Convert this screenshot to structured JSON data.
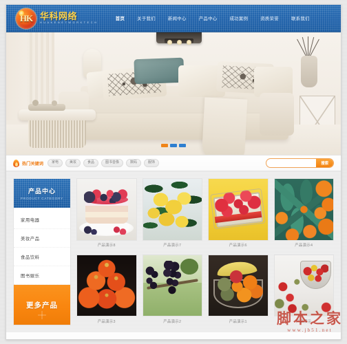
{
  "site": {
    "logo_cn": "华科网络",
    "logo_en": "H U A K E   N E T W O R K   T E C H",
    "logo_mark": "HK"
  },
  "nav": {
    "items": [
      {
        "label": "首页",
        "active": true
      },
      {
        "label": "关于我们",
        "active": false
      },
      {
        "label": "新闻中心",
        "active": false
      },
      {
        "label": "产品中心",
        "active": false
      },
      {
        "label": "成功案例",
        "active": false
      },
      {
        "label": "资质荣誉",
        "active": false
      },
      {
        "label": "联系我们",
        "active": false
      }
    ]
  },
  "banner": {
    "slides": [
      {
        "active": true
      },
      {
        "active": false
      },
      {
        "active": false
      }
    ]
  },
  "keyword_bar": {
    "label": "热门关键词",
    "tags": [
      "家电",
      "美妆",
      "食品",
      "图书音像",
      "数码",
      "服饰"
    ],
    "search": {
      "placeholder": "",
      "value": "",
      "button_label": "搜索"
    }
  },
  "sidebar": {
    "title_cn": "产品中心",
    "title_en": "PRODUCT CATEGORY",
    "items": [
      {
        "label": "家用电器"
      },
      {
        "label": "美妆产品"
      },
      {
        "label": "食品饮料"
      },
      {
        "label": "图书娱乐"
      }
    ],
    "more_label": "更多产品"
  },
  "products": [
    {
      "caption": "产品演示8",
      "art": "cake"
    },
    {
      "caption": "产品演示7",
      "art": "lemons"
    },
    {
      "caption": "产品演示6",
      "art": "rasp"
    },
    {
      "caption": "产品演示4",
      "art": "kumq"
    },
    {
      "caption": "产品演示3",
      "art": "oranges"
    },
    {
      "caption": "产品演示2",
      "art": "grapes"
    },
    {
      "caption": "产品演示1",
      "art": "bowl"
    },
    {
      "caption": "产品演示",
      "art": "cherries"
    }
  ],
  "watermark": {
    "cn": "脚本之家",
    "url": "www.jb51.net"
  },
  "colors": {
    "header_blue": "#1f62ab",
    "accent_orange": "#f0811c",
    "more_orange": "#f9860f",
    "logo_gold": "#ffd24a"
  }
}
